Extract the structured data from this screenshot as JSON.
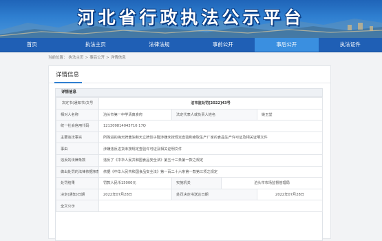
{
  "site": {
    "title": "河北省行政执法公示平台"
  },
  "nav": {
    "items": [
      {
        "label": "首页"
      },
      {
        "label": "执法主页"
      },
      {
        "label": "法律法规"
      },
      {
        "label": "事前公开"
      },
      {
        "label": "事后公开"
      },
      {
        "label": "执法证件"
      }
    ],
    "active_index": 4
  },
  "breadcrumb": {
    "prefix": "当前位置：",
    "items": [
      "执法主页",
      "事后公开",
      "详情信息"
    ],
    "separator": ">"
  },
  "panel": {
    "title": "详情信息",
    "section_head": "详情信息"
  },
  "detail": {
    "doc_label": "决定书(通知书)文号",
    "doc_value": "泊市监处罚[2022]43号",
    "party_label": "相对人名称",
    "party_value": "泊头市第一中学清真食府",
    "legal_rep_label": "法定代表人或负责人姓名",
    "legal_rep_value": "姚玉堂",
    "credit_label": "统一社会信用代码",
    "credit_value": "121309814043716 17Q",
    "fact_label": "主要违法事实",
    "fact_value": "所购进的海天牌酱油和天立牌饺子醋涉嫌未按规定查验和索取生产厂家的食品生产许可证及相关证明文件",
    "cause_label": "事由",
    "cause_value": "涉嫌违反进货未按规定查验许可证及相关证明文件",
    "law_label": "违反的法律条款",
    "law_value": "违反了《中华人民共和国食品安全法》第五十三条第一款之规定",
    "basis_label": "做出处罚的法律依据条款",
    "basis_value": "依据《中华人民共和国食品安全法》第一百二十六条第一款第三项之规定",
    "result_label": "处罚结果",
    "result_value": "罚款人民币15000元",
    "agency_label": "实施机关",
    "agency_value": "泊头市市场监督管理局",
    "date_label": "决定(通知)日期",
    "date_value": "2022年07月28日",
    "delivery_label": "处罚决定书送达日期",
    "delivery_value": "2022年07月28日",
    "fulltext_label": "全文公示",
    "fulltext_value": ""
  }
}
